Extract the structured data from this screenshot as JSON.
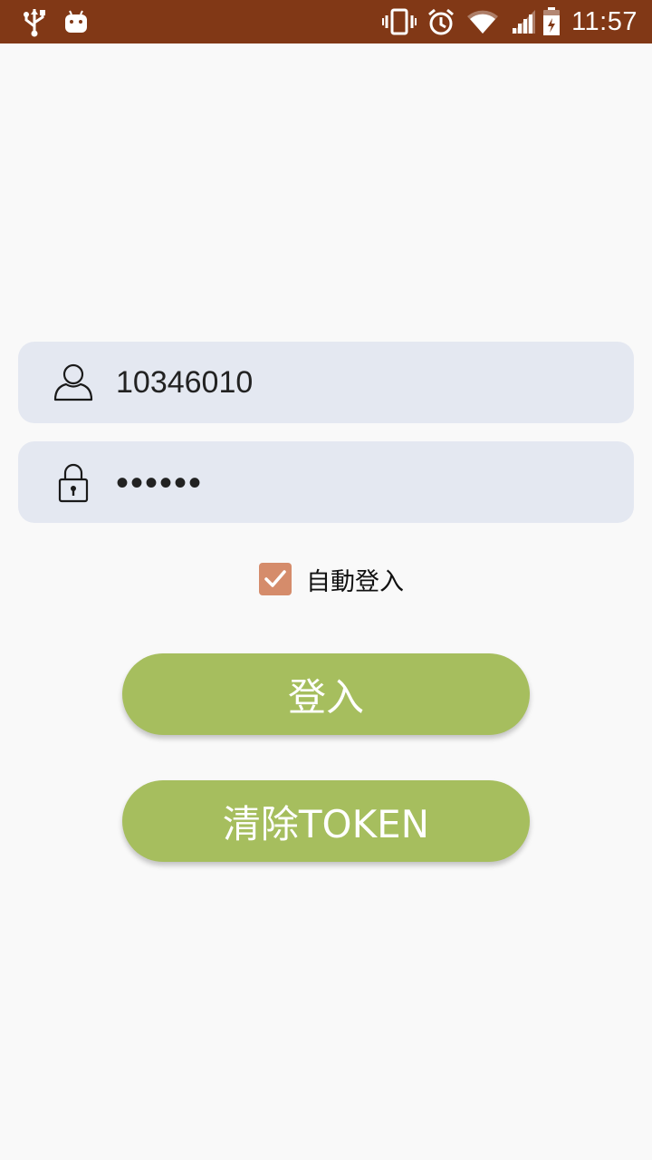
{
  "status_bar": {
    "time": "11:57",
    "background": "#813816",
    "icons": [
      "usb-icon",
      "android-icon",
      "vibrate-icon",
      "alarm-icon",
      "wifi-icon",
      "signal-icon",
      "battery-charging-icon"
    ]
  },
  "form": {
    "username": {
      "value": "10346010",
      "icon": "user-icon"
    },
    "password": {
      "value": "••••••",
      "icon": "lock-icon"
    },
    "auto_login": {
      "label": "自動登入",
      "checked": true,
      "color": "#d58c6b"
    }
  },
  "buttons": {
    "login_label": "登入",
    "clear_token_label": "清除TOKEN",
    "color": "#a6be5e"
  }
}
